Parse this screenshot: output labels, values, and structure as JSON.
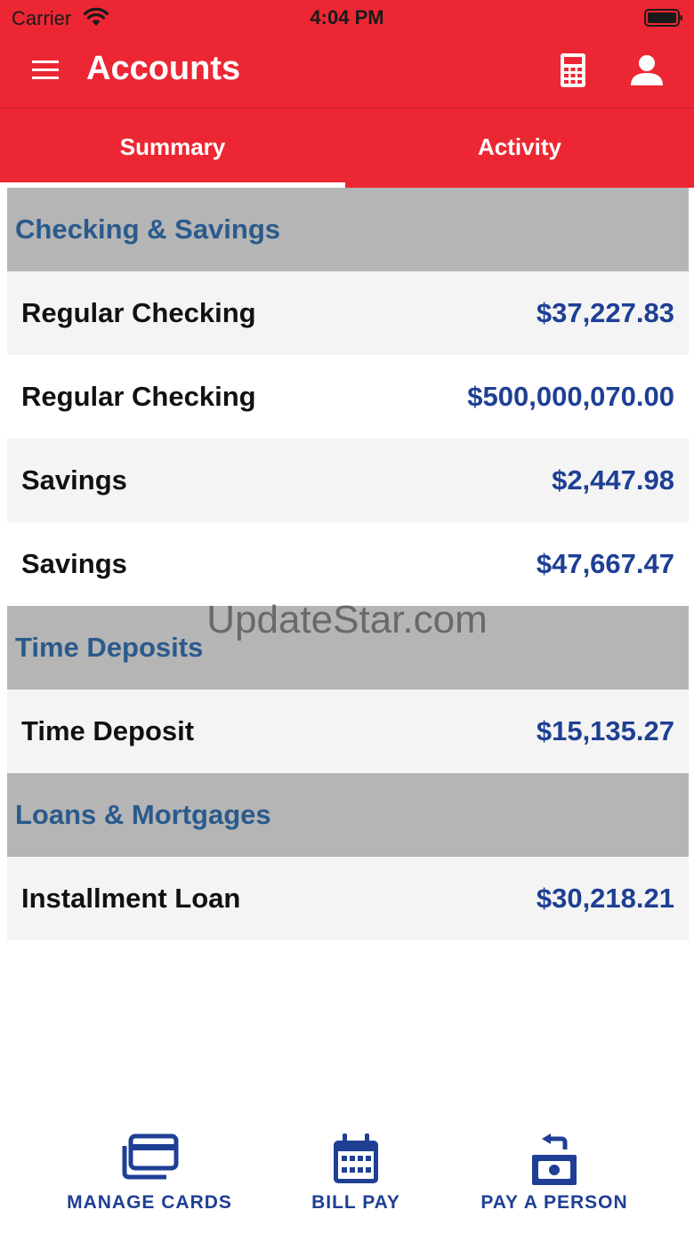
{
  "status_bar": {
    "carrier": "Carrier",
    "time": "4:04 PM"
  },
  "nav": {
    "title": "Accounts"
  },
  "tabs": [
    {
      "label": "Summary"
    },
    {
      "label": "Activity"
    }
  ],
  "sections": [
    {
      "title": "Checking & Savings",
      "accounts": [
        {
          "name": "Regular Checking",
          "amount": "$37,227.83"
        },
        {
          "name": "Regular Checking",
          "amount": "$500,000,070.00"
        },
        {
          "name": "Savings",
          "amount": "$2,447.98"
        },
        {
          "name": "Savings",
          "amount": "$47,667.47"
        }
      ]
    },
    {
      "title": "Time Deposits",
      "accounts": [
        {
          "name": "Time Deposit",
          "amount": "$15,135.27"
        }
      ]
    },
    {
      "title": "Loans & Mortgages",
      "accounts": [
        {
          "name": "Installment Loan",
          "amount": "$30,218.21"
        }
      ]
    }
  ],
  "watermark": "UpdateStar.com",
  "bottom_nav": [
    {
      "label": "MANAGE CARDS",
      "icon": "credit-cards-icon"
    },
    {
      "label": "BILL PAY",
      "icon": "calendar-icon"
    },
    {
      "label": "PAY A PERSON",
      "icon": "cash-transfer-icon"
    }
  ],
  "colors": {
    "header": "#ec2733",
    "section_bg": "#b5b5b5",
    "section_text": "#2a5a8c",
    "amount": "#1e3f94"
  }
}
